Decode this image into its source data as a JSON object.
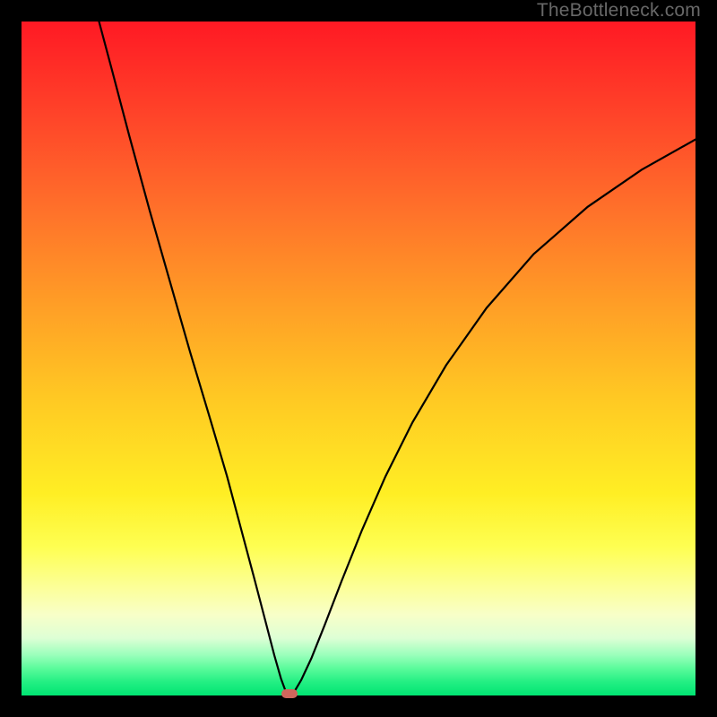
{
  "watermark": "TheBottleneck.com",
  "chart_data": {
    "type": "line",
    "title": "",
    "xlabel": "",
    "ylabel": "",
    "xlim": [
      0,
      100
    ],
    "ylim": [
      0,
      100
    ],
    "curve_points": [
      {
        "x": 11.5,
        "y": 100
      },
      {
        "x": 13.5,
        "y": 92.5
      },
      {
        "x": 16,
        "y": 83
      },
      {
        "x": 19,
        "y": 72
      },
      {
        "x": 22,
        "y": 61.5
      },
      {
        "x": 25,
        "y": 51
      },
      {
        "x": 28,
        "y": 41
      },
      {
        "x": 30.5,
        "y": 32.5
      },
      {
        "x": 32.5,
        "y": 25
      },
      {
        "x": 34.5,
        "y": 17.5
      },
      {
        "x": 36.2,
        "y": 11
      },
      {
        "x": 37.5,
        "y": 6
      },
      {
        "x": 38.5,
        "y": 2.5
      },
      {
        "x": 39.2,
        "y": 0.6
      },
      {
        "x": 39.8,
        "y": 0.1
      },
      {
        "x": 40.5,
        "y": 0.6
      },
      {
        "x": 41.5,
        "y": 2.3
      },
      {
        "x": 43,
        "y": 5.5
      },
      {
        "x": 45,
        "y": 10.5
      },
      {
        "x": 47.5,
        "y": 17
      },
      {
        "x": 50.5,
        "y": 24.5
      },
      {
        "x": 54,
        "y": 32.5
      },
      {
        "x": 58,
        "y": 40.5
      },
      {
        "x": 63,
        "y": 49
      },
      {
        "x": 69,
        "y": 57.5
      },
      {
        "x": 76,
        "y": 65.5
      },
      {
        "x": 84,
        "y": 72.5
      },
      {
        "x": 92,
        "y": 78
      },
      {
        "x": 100,
        "y": 82.5
      }
    ],
    "minimum_marker": {
      "x": 39.8,
      "y": 0.2
    },
    "gradient_description": "vertical rainbow gradient from red (top, high bottleneck) to green (bottom, low bottleneck)"
  }
}
